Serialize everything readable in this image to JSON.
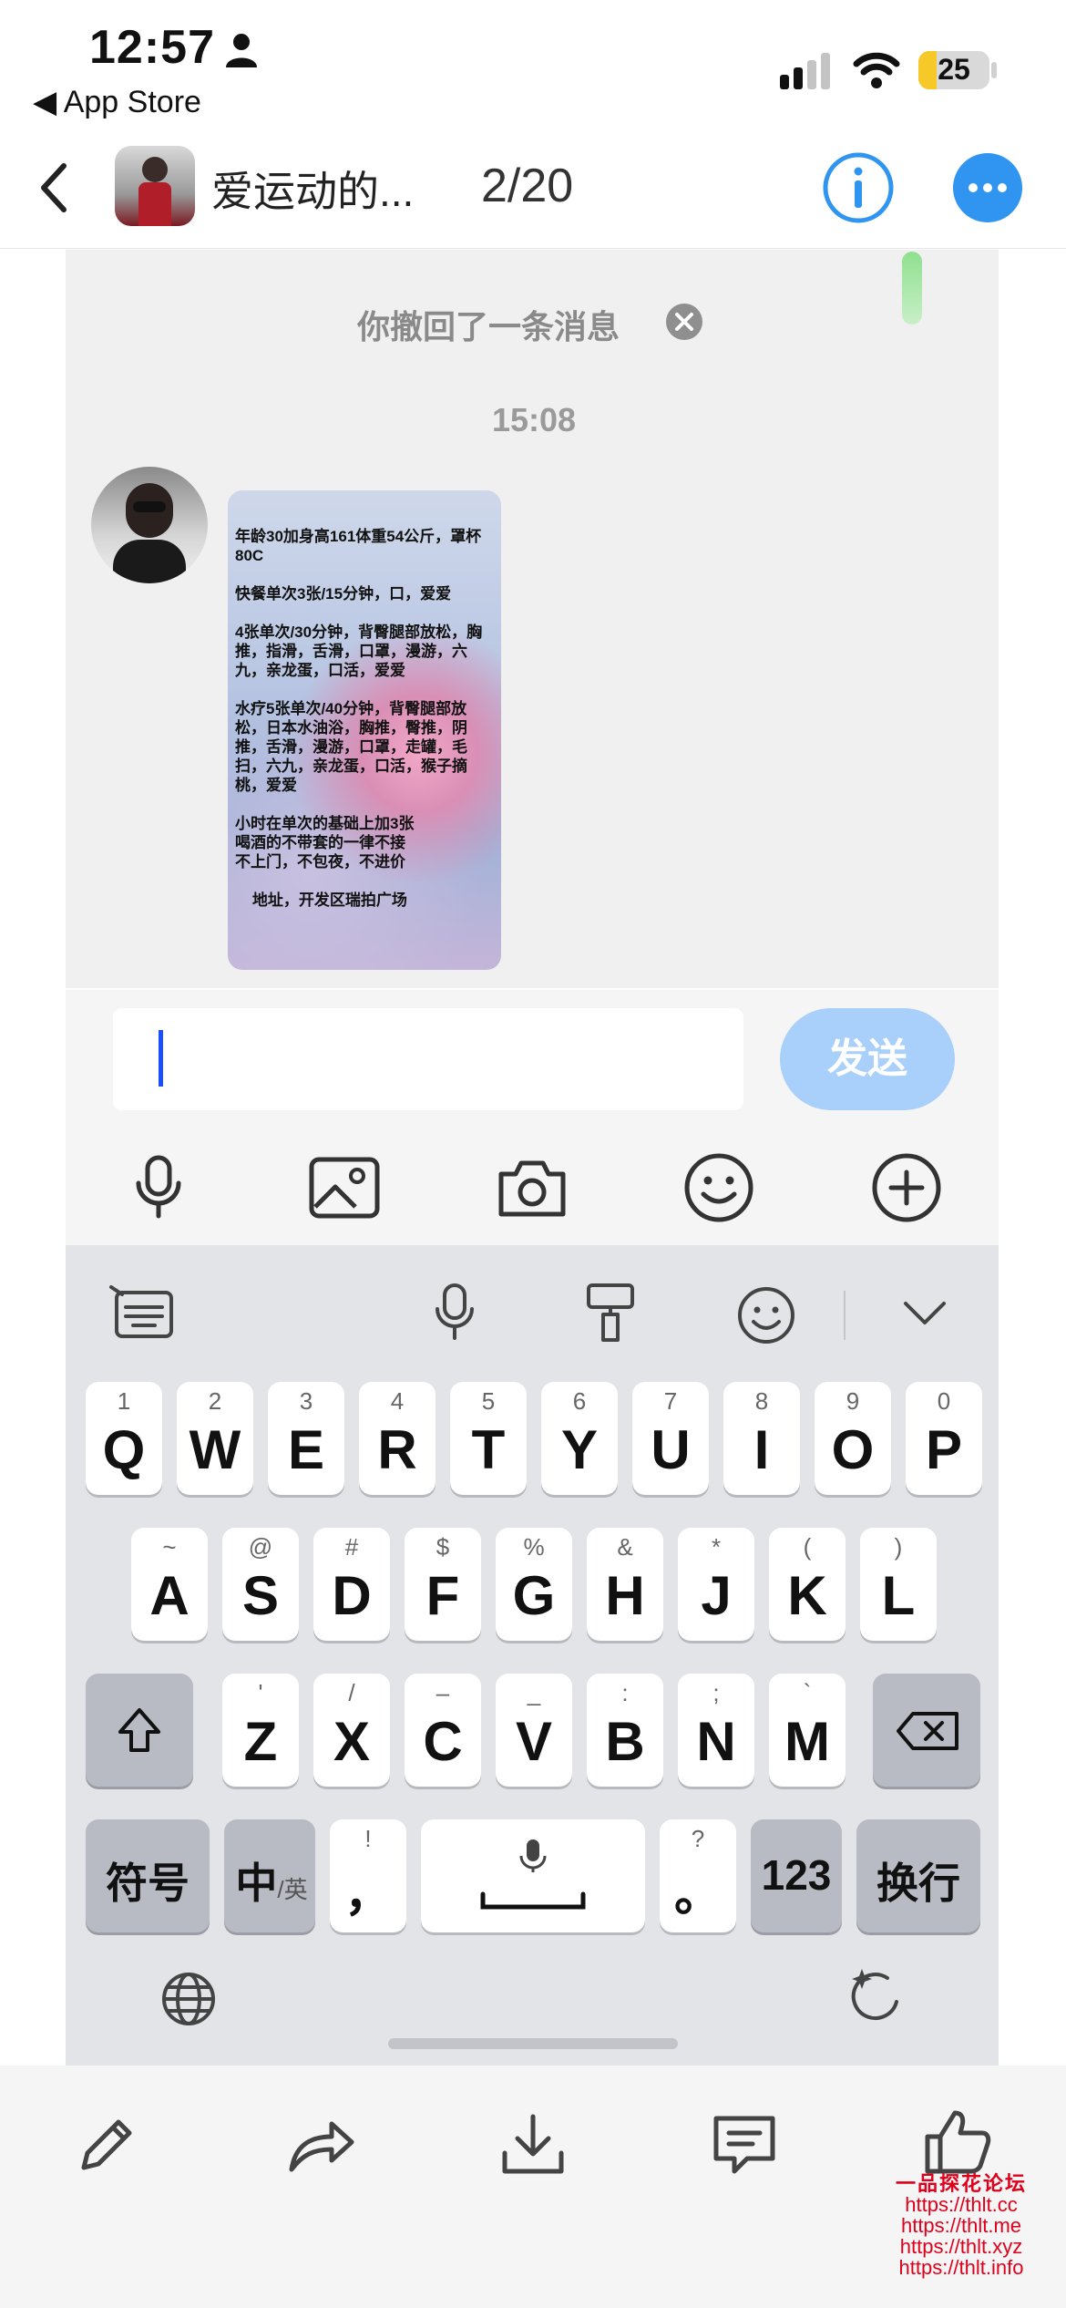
{
  "status_bar": {
    "time": "12:57",
    "back_app": "◀ App Store",
    "battery": "25"
  },
  "header": {
    "title": "爱运动的...",
    "page_counter": "2/20"
  },
  "chat": {
    "recall_notice": "你撤回了一条消息",
    "timestamp": "15:08",
    "image_text": "年龄30加身高161体重54公斤，罩杯80C\n\n快餐单次3张/15分钟，口，爱爱\n\n4张单次/30分钟，背臀腿部放松，胸推，指滑，舌滑，口罩，漫游，六九，亲龙蛋，口活，爱爱\n\n水疗5张单次/40分钟，背臀腿部放松，日本水油浴，胸推，臀推，阴推，舌滑，漫游，口罩，走罐，毛扫，六九，亲龙蛋，口活，猴子摘桃，爱爱\n\n小时在单次的基础上加3张\n喝酒的不带套的一律不接\n不上门，不包夜，不进价\n\n    地址，开发区瑞拍广场"
  },
  "input": {
    "value": "",
    "send_label": "发送"
  },
  "keyboard": {
    "row1": [
      {
        "num": "1",
        "letter": "Q"
      },
      {
        "num": "2",
        "letter": "W"
      },
      {
        "num": "3",
        "letter": "E"
      },
      {
        "num": "4",
        "letter": "R"
      },
      {
        "num": "5",
        "letter": "T"
      },
      {
        "num": "6",
        "letter": "Y"
      },
      {
        "num": "7",
        "letter": "U"
      },
      {
        "num": "8",
        "letter": "I"
      },
      {
        "num": "9",
        "letter": "O"
      },
      {
        "num": "0",
        "letter": "P"
      }
    ],
    "row2": [
      {
        "num": "~",
        "letter": "A"
      },
      {
        "num": "@",
        "letter": "S"
      },
      {
        "num": "#",
        "letter": "D"
      },
      {
        "num": "$",
        "letter": "F"
      },
      {
        "num": "%",
        "letter": "G"
      },
      {
        "num": "&",
        "letter": "H"
      },
      {
        "num": "*",
        "letter": "J"
      },
      {
        "num": "(",
        "letter": "K"
      },
      {
        "num": ")",
        "letter": "L"
      }
    ],
    "row3": [
      {
        "num": "'",
        "letter": "Z"
      },
      {
        "num": "/",
        "letter": "X"
      },
      {
        "num": "–",
        "letter": "C"
      },
      {
        "num": "_",
        "letter": "V"
      },
      {
        "num": ":",
        "letter": "B"
      },
      {
        "num": ";",
        "letter": "N"
      },
      {
        "num": "`",
        "letter": "M"
      }
    ],
    "symbols_label": "符号",
    "lang_main": "中",
    "lang_alt": "/英",
    "comma_top": "!",
    "comma": "，",
    "period_top": "?",
    "period": "。",
    "num_label": "123",
    "enter_label": "换行"
  },
  "watermark": {
    "title": "一品探花论坛",
    "urls": [
      "https://thlt.cc",
      "https://thlt.me",
      "https://thlt.xyz",
      "https://thlt.info"
    ]
  },
  "colors": {
    "accent": "#2F95F0",
    "send_button": "#A8D0FB",
    "caret": "#1A4FFF",
    "watermark": "#E0001B"
  }
}
